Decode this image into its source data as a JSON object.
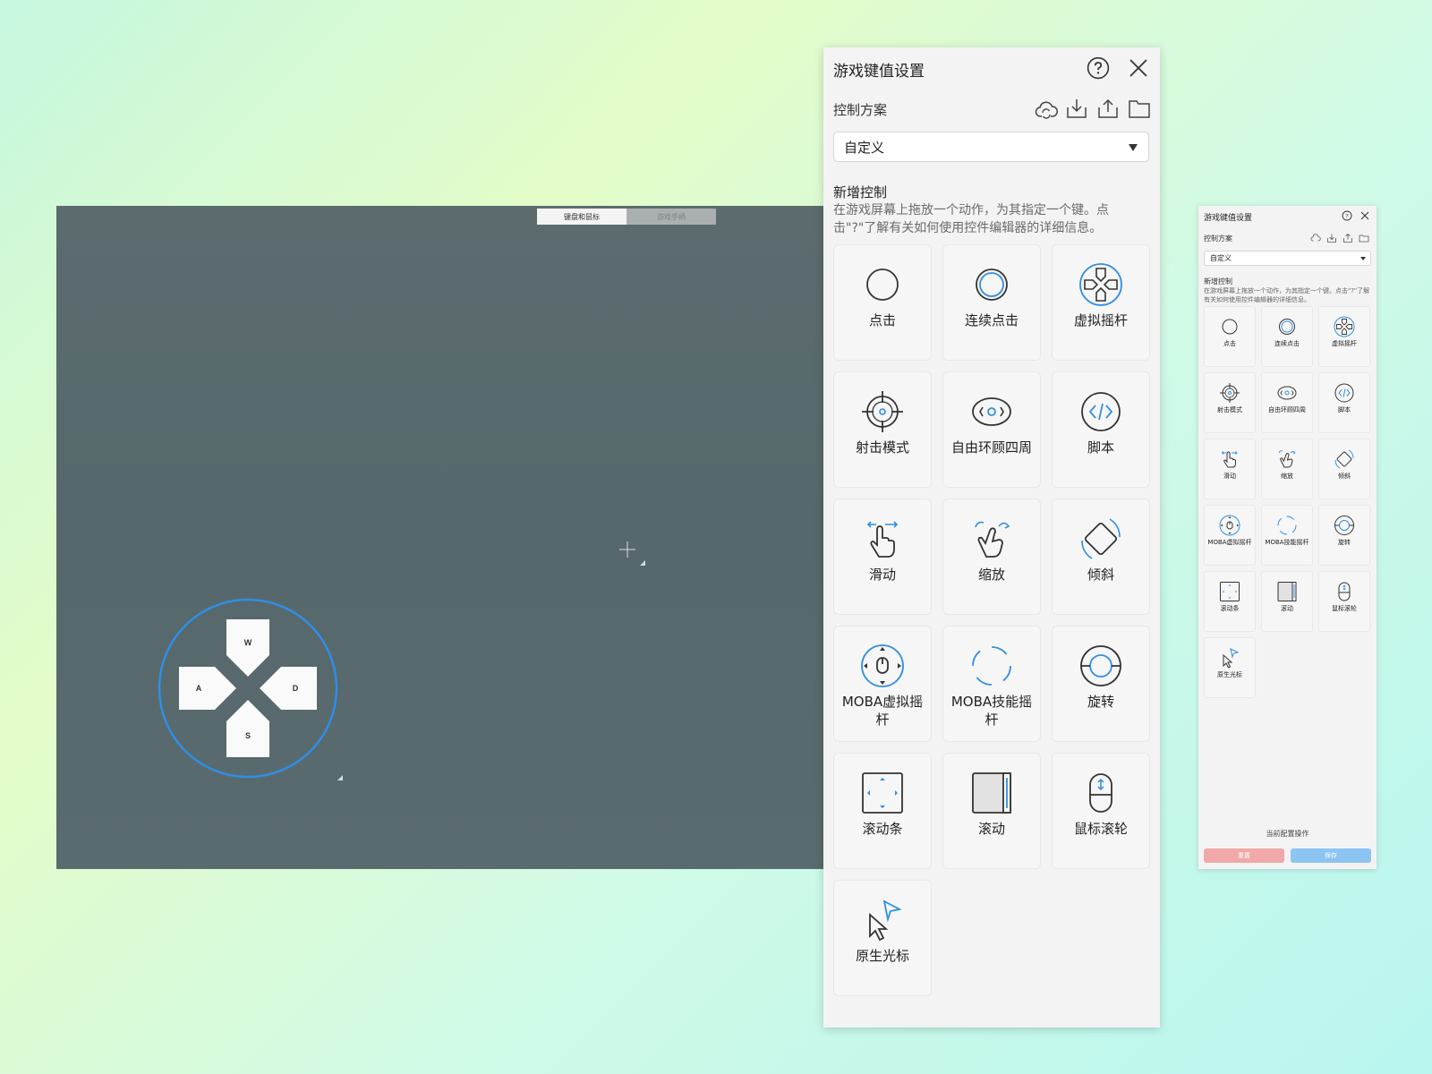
{
  "game": {
    "tabs": [
      {
        "label": "键盘和鼠标",
        "active": true
      },
      {
        "label": "游戏手柄",
        "active": false
      }
    ],
    "dpad": {
      "up": "W",
      "left": "A",
      "right": "D",
      "down": "S"
    }
  },
  "panel": {
    "title": "游戏键值设置",
    "scheme_label": "控制方案",
    "scheme_value": "自定义",
    "add_title": "新增控制",
    "add_desc": "在游戏屏幕上拖放一个动作，为其指定一个键。点击\"?\"了解有关如何使用控件编辑器的详细信息。",
    "controls": [
      {
        "label": "点击",
        "icon": "tap-icon"
      },
      {
        "label": "连续点击",
        "icon": "continuous-tap-icon"
      },
      {
        "label": "虚拟摇杆",
        "icon": "virtual-joystick-icon"
      },
      {
        "label": "射击模式",
        "icon": "shoot-mode-icon"
      },
      {
        "label": "自由环顾四周",
        "icon": "free-look-icon"
      },
      {
        "label": "脚本",
        "icon": "script-icon"
      },
      {
        "label": "滑动",
        "icon": "swipe-icon"
      },
      {
        "label": "缩放",
        "icon": "zoom-icon"
      },
      {
        "label": "倾斜",
        "icon": "tilt-icon"
      },
      {
        "label": "MOBA虚拟摇杆",
        "icon": "moba-joystick-icon"
      },
      {
        "label": "MOBA技能摇杆",
        "icon": "moba-skill-icon"
      },
      {
        "label": "旋转",
        "icon": "rotate-icon"
      },
      {
        "label": "滚动条",
        "icon": "scrollbar-icon"
      },
      {
        "label": "滚动",
        "icon": "scroll-icon"
      },
      {
        "label": "鼠标滚轮",
        "icon": "mouse-wheel-icon"
      },
      {
        "label": "原生光标",
        "icon": "native-cursor-icon"
      }
    ]
  },
  "mini": {
    "title": "游戏键值设置",
    "scheme_label": "控制方案",
    "scheme_value": "自定义",
    "add_title": "新增控制",
    "add_desc": "在游戏屏幕上拖放一个动作，为其指定一个键。点击\"?\"了解有关如何使用控件编辑器的详细信息。",
    "footer": "当前配置操作",
    "reset_label": "重置",
    "save_label": "保存"
  },
  "colors": {
    "accent": "#2f8ee6",
    "icon": "#333333",
    "reset": "#f0a8a8",
    "save": "#8cc4f2"
  }
}
